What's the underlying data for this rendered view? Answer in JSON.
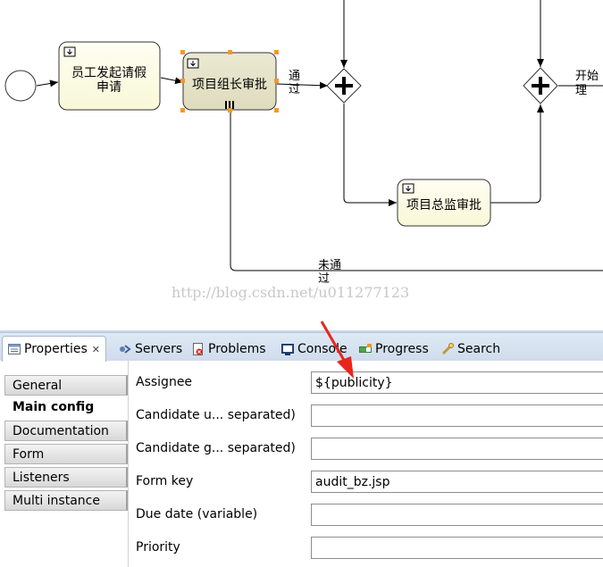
{
  "diagram": {
    "tasks": [
      {
        "lines": [
          "员工发起请假",
          "申请"
        ],
        "style": "normal"
      },
      {
        "lines": [
          "项目组长审批"
        ],
        "style": "selected"
      },
      {
        "lines": [
          "项目总监审批"
        ],
        "style": "normal"
      }
    ],
    "flow_labels": [
      {
        "lines": [
          "通",
          "过"
        ]
      },
      {
        "lines": [
          "开始",
          "理"
        ]
      },
      {
        "lines": [
          "未通",
          "过"
        ]
      }
    ],
    "watermark": "http://blog.csdn.net/u011277123",
    "colors": {
      "task_fill": "#fdfde0",
      "task_selected_fill": "#e3e0c4",
      "handle": "#f39a24",
      "arrow_annotation": "#e8251d"
    }
  },
  "tabs": [
    {
      "label": "Properties",
      "icon": "properties-icon",
      "active": true,
      "close": "✕"
    },
    {
      "label": "Servers",
      "icon": "servers-icon"
    },
    {
      "label": "Problems",
      "icon": "problems-icon"
    },
    {
      "label": "Console",
      "icon": "console-icon"
    },
    {
      "label": "Progress",
      "icon": "progress-icon"
    },
    {
      "label": "Search",
      "icon": "search-icon"
    }
  ],
  "nav": [
    {
      "label": "General",
      "active": false
    },
    {
      "label": "Main config",
      "active": true
    },
    {
      "label": "Documentation",
      "active": false
    },
    {
      "label": "Form",
      "active": false
    },
    {
      "label": "Listeners",
      "active": false
    },
    {
      "label": "Multi instance",
      "active": false
    }
  ],
  "fields": [
    {
      "label": "Assignee",
      "value": "${publicity}"
    },
    {
      "label": "Candidate u... separated)",
      "value": ""
    },
    {
      "label": "Candidate g... separated)",
      "value": ""
    },
    {
      "label": "Form key",
      "value": "audit_bz.jsp"
    },
    {
      "label": "Due date (variable)",
      "value": ""
    },
    {
      "label": "Priority",
      "value": ""
    }
  ]
}
